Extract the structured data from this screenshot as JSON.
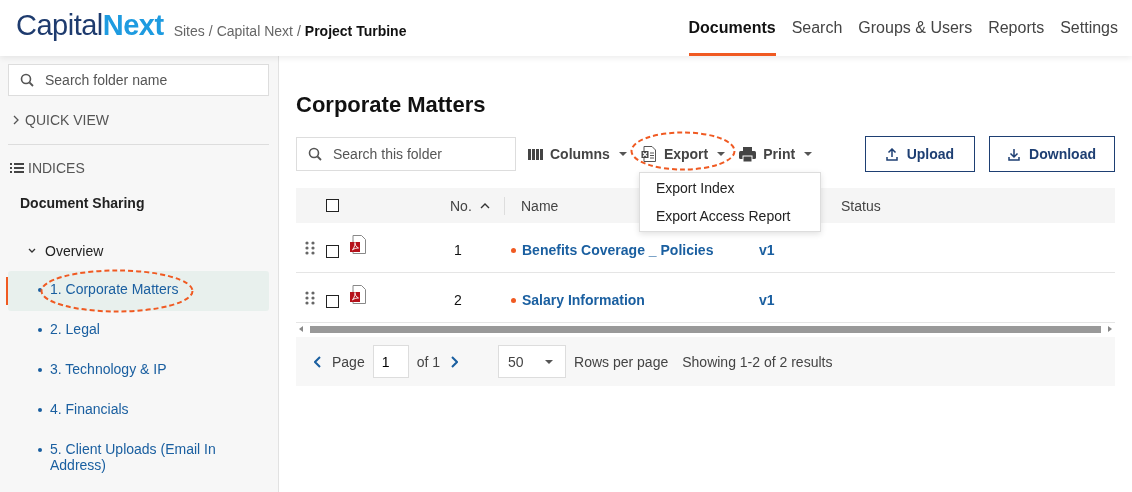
{
  "header": {
    "logo": {
      "part_1": "Capital",
      "part_2": "Next"
    },
    "breadcrumb_separator": "/",
    "breadcrumb": [
      {
        "label": "Sites",
        "current": false
      },
      {
        "label": "Capital Next",
        "current": false
      },
      {
        "label": "Project Turbine",
        "current": true
      }
    ],
    "nav": [
      {
        "label": "Documents",
        "selected": true
      },
      {
        "label": "Search",
        "selected": false
      },
      {
        "label": "Groups & Users",
        "selected": false
      },
      {
        "label": "Reports",
        "selected": false
      },
      {
        "label": "Settings",
        "selected": false
      }
    ]
  },
  "sidebar": {
    "search": {
      "placeholder": "Search folder name"
    },
    "quick_view": {
      "label": "QUICK VIEW",
      "expanded": false
    },
    "indices_label": "INDICES",
    "section": "Document Sharing",
    "tree": [
      {
        "label": "Overview",
        "expanded": true,
        "children": [
          {
            "label": "1. Corporate Matters",
            "selected": true,
            "circled": true
          },
          {
            "label": "2. Legal",
            "selected": false,
            "circled": false
          },
          {
            "label": "3. Technology & IP",
            "selected": false,
            "circled": false
          },
          {
            "label": "4. Financials",
            "selected": false,
            "circled": false
          },
          {
            "label": "5. Client Uploads (Email In Address)",
            "selected": false,
            "circled": false
          }
        ]
      }
    ]
  },
  "main": {
    "title": "Corporate Matters",
    "search": {
      "placeholder": "Search this folder"
    },
    "toolbar": [
      {
        "kind": "columns",
        "label": "Columns",
        "circled": false
      },
      {
        "kind": "export",
        "label": "Export",
        "circled": true,
        "menu": [
          "Export Index",
          "Export Access Report"
        ]
      },
      {
        "kind": "print",
        "label": "Print",
        "circled": false
      }
    ],
    "buttons": [
      {
        "kind": "upload",
        "label": "Upload"
      },
      {
        "kind": "download",
        "label": "Download"
      }
    ],
    "table": {
      "all_checked": false,
      "columns": [
        {
          "label": "No.",
          "sorted_ascending": true
        },
        {
          "label": "Name",
          "sorted_ascending": false
        },
        {
          "label": "Status",
          "sorted_ascending": false
        }
      ],
      "rows": [
        {
          "checked": false,
          "no": "1",
          "name": "Benefits Coverage _ Policies",
          "version": "v1"
        },
        {
          "checked": false,
          "no": "2",
          "name": "Salary Information",
          "version": "v1"
        }
      ]
    },
    "pagination": {
      "page_label": "Page",
      "page": "1",
      "of_label": "of 1",
      "rows_per_page": "50",
      "rows_per_page_label": "Rows per page",
      "summary": "Showing 1-2 of 2 results"
    }
  }
}
